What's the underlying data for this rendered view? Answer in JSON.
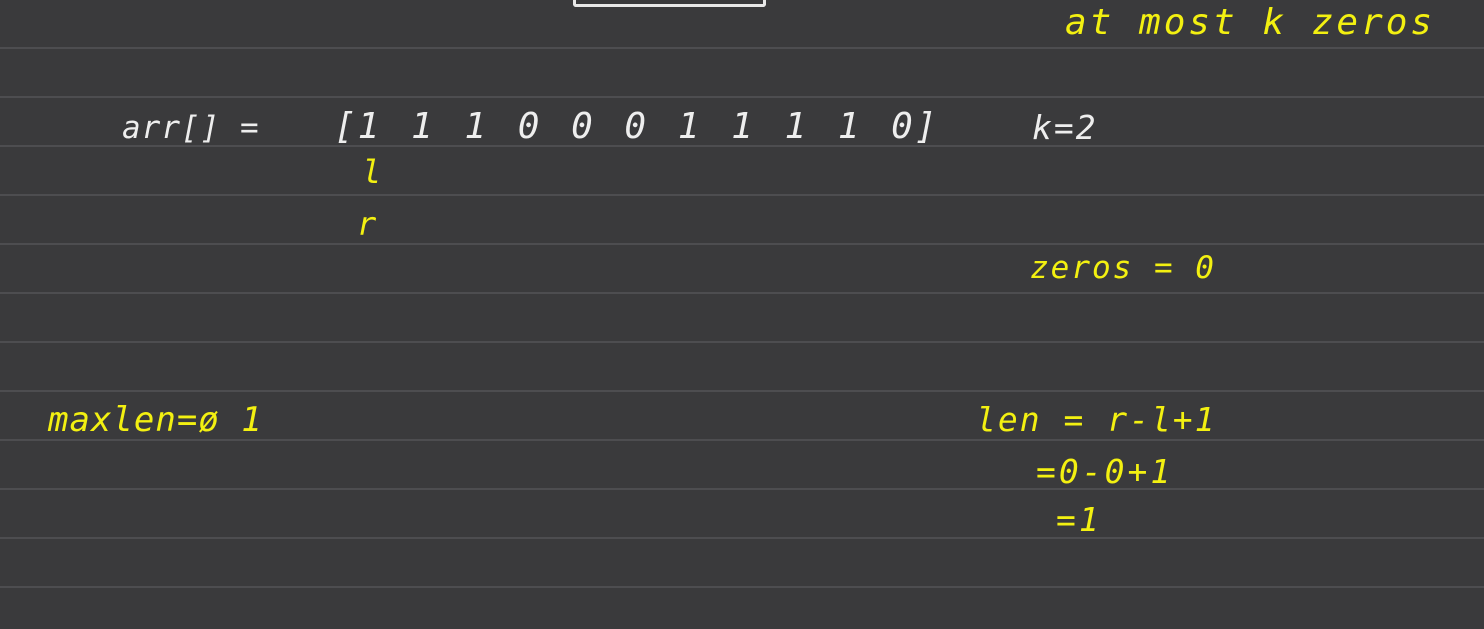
{
  "board": {
    "background": "#3a3a3c",
    "ink_white": "#eeeeee",
    "ink_yellow": "#f3f011"
  },
  "notes": {
    "array_label": "arr[] =",
    "array_values": "[1 1 1 0 0 0 1 1 1 1 0]",
    "k_label": "k=2",
    "top_note": "at most k zeros",
    "l_pointer": "l",
    "r_pointer": "r",
    "zeros_label": "zeros = 0",
    "maxlen_label": "maxlen=ø 1",
    "len_line1": "len = r-l+1",
    "len_line2": "=0-0+1",
    "len_line3": "=1"
  }
}
